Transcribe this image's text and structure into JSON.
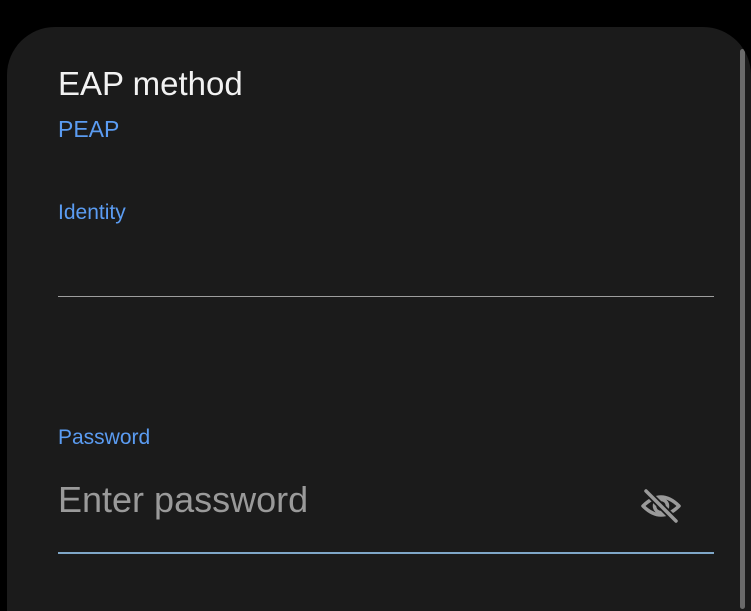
{
  "sheet": {
    "eap_method": {
      "title": "EAP method",
      "value": "PEAP"
    },
    "identity": {
      "label": "Identity",
      "value": ""
    },
    "password": {
      "label": "Password",
      "placeholder": "Enter password",
      "visibility_icon": "eye-off-icon"
    }
  },
  "colors": {
    "background": "#000000",
    "sheet": "#1b1b1b",
    "accent": "#5b9cf2",
    "primary_text": "#f2f2f2",
    "placeholder_text": "#9a9a9a",
    "focused_underline": "#7fa7c8"
  }
}
